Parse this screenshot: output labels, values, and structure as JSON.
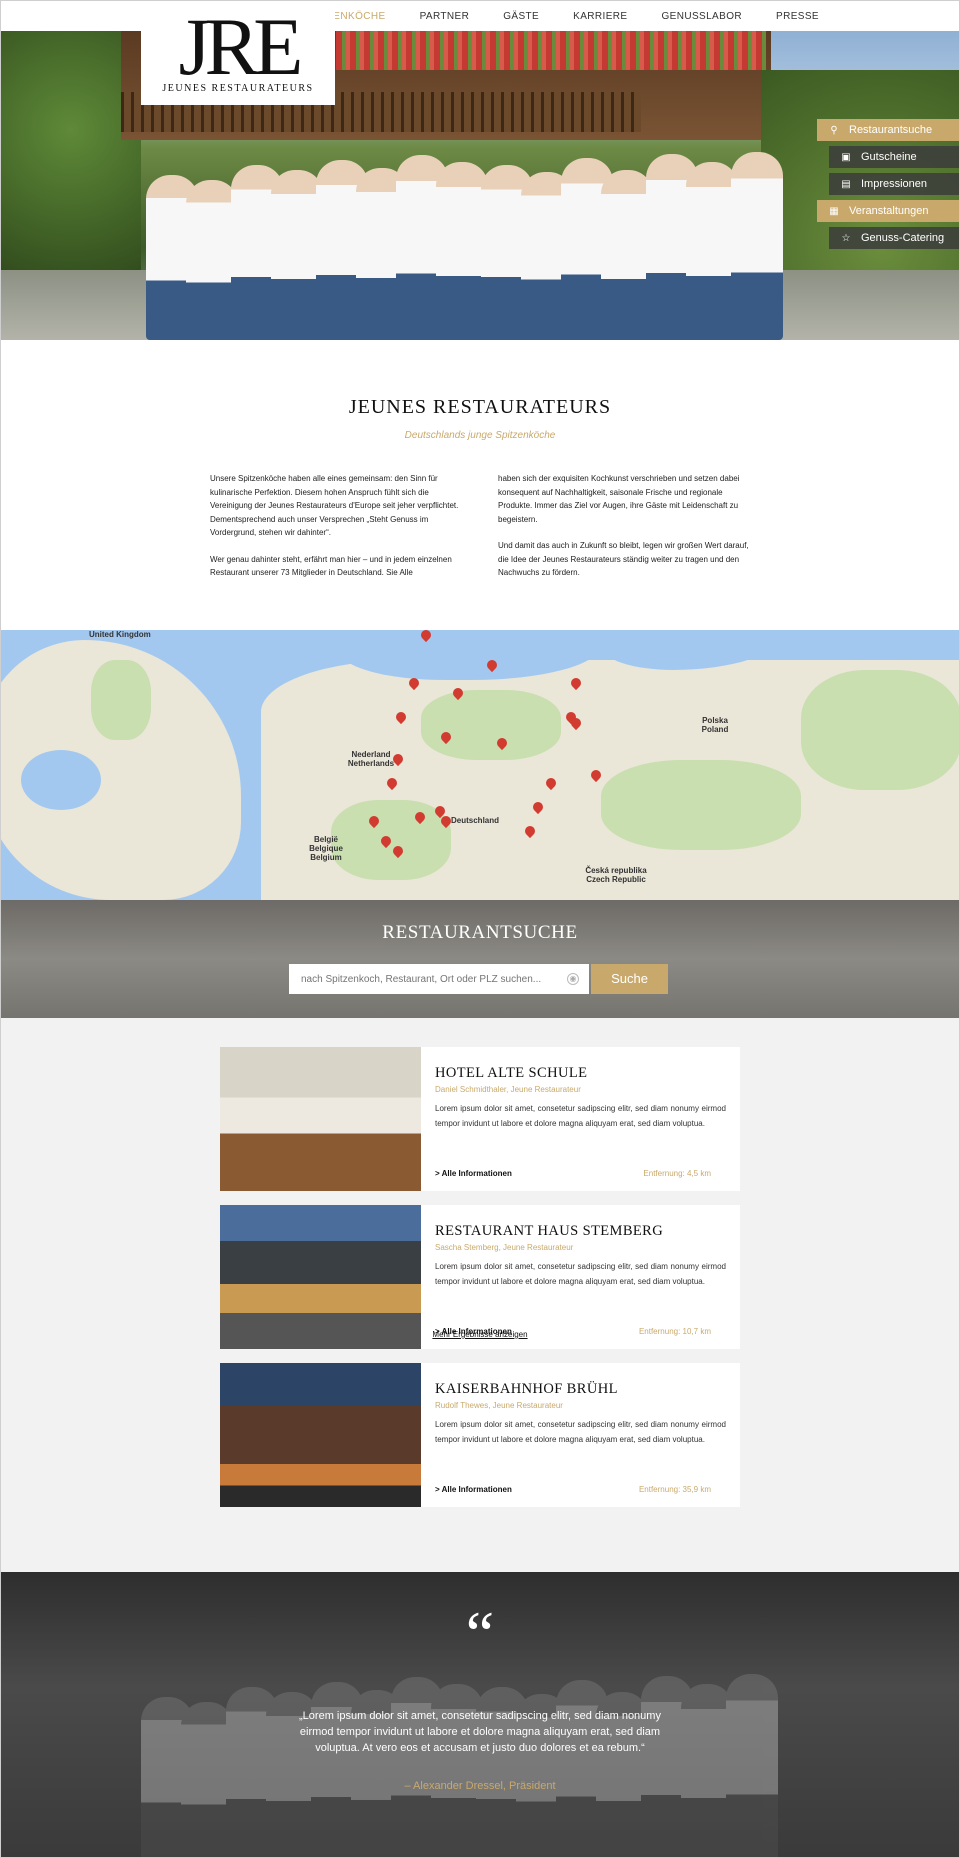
{
  "nav": {
    "items": [
      "Spitzenköche",
      "Partner",
      "Gäste",
      "Karriere",
      "Genusslabor",
      "Presse"
    ],
    "active_index": 0
  },
  "logo": {
    "mark": "JRE",
    "subtitle": "Jeunes Restaurateurs"
  },
  "side_buttons": [
    {
      "label": "Restaurantsuche",
      "icon": "search-icon",
      "style": "gold"
    },
    {
      "label": "Gutscheine",
      "icon": "gift-icon",
      "style": "dark"
    },
    {
      "label": "Impressionen",
      "icon": "image-icon",
      "style": "dark"
    },
    {
      "label": "Veranstaltungen",
      "icon": "calendar-icon",
      "style": "gold"
    },
    {
      "label": "Genuss-Catering",
      "icon": "star-icon",
      "style": "dark"
    }
  ],
  "intro": {
    "title": "JEUNES RESTAURATEURS",
    "subtitle": "Deutschlands junge Spitzenköche",
    "col1_p1": "Unsere Spitzenköche haben alle eines gemeinsam: den Sinn für kulinarische Perfektion. Diesem hohen Anspruch fühlt sich die Vereinigung der Jeunes Restaurateurs d'Europe seit jeher verpflichtet. Dementsprechend auch unser Versprechen „Steht Genuss im Vordergrund, stehen wir dahinter“.",
    "col1_p2": "Wer genau dahinter steht, erfährt man hier – und in jedem einzelnen Restaurant unserer 73 Mitglieder in Deutschland. Sie Alle",
    "col2_p1": "haben sich der exquisiten Kochkunst verschrieben und setzen dabei konsequent auf Nachhaltigkeit, saisonale Frische und regionale Produkte. Immer das Ziel vor Augen, ihre Gäste mit Leidenschaft zu begeistern.",
    "col2_p2": "Und damit das auch in Zukunft so bleibt, legen wir großen Wert darauf, die Idee der Jeunes Restaurateurs ständig weiter zu tragen und den Nachwuchs zu fördern."
  },
  "map": {
    "labels": {
      "uk": "United Kingdom",
      "nl": "Nederland Netherlands",
      "be": "België Belgique Belgium",
      "de": "Deutschland",
      "pl": "Polska Poland",
      "cz": "Česká republika Czech Republic"
    }
  },
  "search": {
    "title": "RESTAURANTSUCHE",
    "placeholder": "nach Spitzenkoch, Restaurant, Ort oder PLZ suchen...",
    "button": "Suche"
  },
  "results": [
    {
      "name": "HOTEL ALTE SCHULE",
      "chef": "Daniel Schmidthaler, Jeune Restaurateur",
      "text": "Lorem ipsum dolor sit amet, consetetur sadipscing elitr, sed diam nonumy eirmod tempor invidunt ut labore et dolore magna aliquyam erat, sed diam voluptua.",
      "more": "> Alle Informationen",
      "distance": "Entfernung: 4,5 km"
    },
    {
      "name": "RESTAURANT HAUS STEMBERG",
      "chef": "Sascha Stemberg, Jeune Restaurateur",
      "text": "Lorem ipsum dolor sit amet, consetetur sadipscing elitr, sed diam nonumy eirmod tempor invidunt ut labore et dolore magna aliquyam erat, sed diam voluptua.",
      "more": "> Alle Informationen",
      "distance": "Entfernung: 10,7 km"
    },
    {
      "name": "KAISERBAHNHOF BRÜHL",
      "chef": "Rudolf Thewes, Jeune Restaurateur",
      "text": "Lorem ipsum dolor sit amet, consetetur sadipscing elitr, sed diam nonumy eirmod tempor invidunt ut labore et dolore magna aliquyam erat, sed diam voluptua.",
      "more": "> Alle Informationen",
      "distance": "Entfernung: 35,9 km"
    }
  ],
  "show_more": "Mehr Ergebnisse anzeigen",
  "quote": {
    "mark": "“",
    "text": "„Lorem ipsum dolor sit amet, consetetur sadipscing elitr, sed diam nonumy eirmod tempor invidunt ut labore et dolore magna aliquyam erat, sed diam voluptua. At vero eos et accusam et justo duo dolores et ea rebum.“",
    "author": "– Alexander Dressel, Präsident"
  },
  "colors": {
    "gold": "#c9a96b",
    "dark_button": "#3c3c3c"
  }
}
